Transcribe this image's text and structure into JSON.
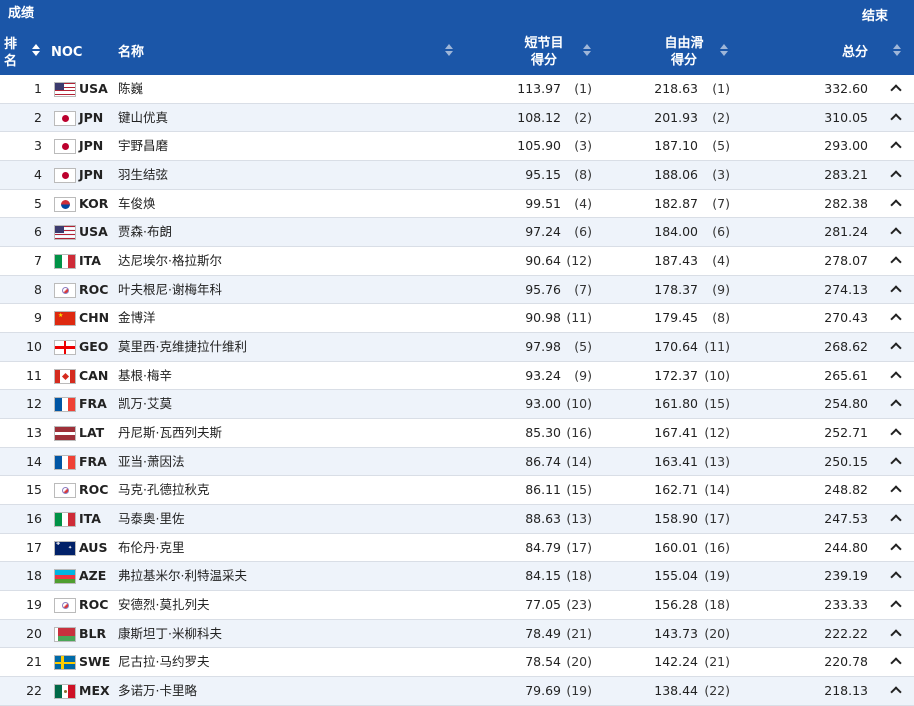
{
  "header": {
    "title": "成绩",
    "status": "结束",
    "columns": {
      "rank_line1": "排",
      "rank_line2": "名",
      "noc": "NOC",
      "name": "名称",
      "sp_line1": "短节目",
      "sp_line2": "得分",
      "fs_line1": "自由滑",
      "fs_line2": "得分",
      "total": "总分"
    }
  },
  "icons": {
    "sort": "sort-arrows-icon",
    "expand": "chevron-up-icon"
  },
  "colors": {
    "header_bg": "#1b56a8",
    "row_alt_bg": "#eef3fa"
  },
  "rows": [
    {
      "rank": "1",
      "noc": "USA",
      "name": "陈巍",
      "sp": "113.97",
      "sp_rank": "(1)",
      "fs": "218.63",
      "fs_rank": "(1)",
      "total": "332.60"
    },
    {
      "rank": "2",
      "noc": "JPN",
      "name": "键山优真",
      "sp": "108.12",
      "sp_rank": "(2)",
      "fs": "201.93",
      "fs_rank": "(2)",
      "total": "310.05"
    },
    {
      "rank": "3",
      "noc": "JPN",
      "name": "宇野昌磨",
      "sp": "105.90",
      "sp_rank": "(3)",
      "fs": "187.10",
      "fs_rank": "(5)",
      "total": "293.00"
    },
    {
      "rank": "4",
      "noc": "JPN",
      "name": "羽生结弦",
      "sp": "95.15",
      "sp_rank": "(8)",
      "fs": "188.06",
      "fs_rank": "(3)",
      "total": "283.21"
    },
    {
      "rank": "5",
      "noc": "KOR",
      "name": "车俊焕",
      "sp": "99.51",
      "sp_rank": "(4)",
      "fs": "182.87",
      "fs_rank": "(7)",
      "total": "282.38"
    },
    {
      "rank": "6",
      "noc": "USA",
      "name": "贾森·布朗",
      "sp": "97.24",
      "sp_rank": "(6)",
      "fs": "184.00",
      "fs_rank": "(6)",
      "total": "281.24"
    },
    {
      "rank": "7",
      "noc": "ITA",
      "name": "达尼埃尔·格拉斯尔",
      "sp": "90.64",
      "sp_rank": "(12)",
      "fs": "187.43",
      "fs_rank": "(4)",
      "total": "278.07"
    },
    {
      "rank": "8",
      "noc": "ROC",
      "name": "叶夫根尼·谢梅年科",
      "sp": "95.76",
      "sp_rank": "(7)",
      "fs": "178.37",
      "fs_rank": "(9)",
      "total": "274.13"
    },
    {
      "rank": "9",
      "noc": "CHN",
      "name": "金博洋",
      "sp": "90.98",
      "sp_rank": "(11)",
      "fs": "179.45",
      "fs_rank": "(8)",
      "total": "270.43"
    },
    {
      "rank": "10",
      "noc": "GEO",
      "name": "莫里西·克维捷拉什维利",
      "sp": "97.98",
      "sp_rank": "(5)",
      "fs": "170.64",
      "fs_rank": "(11)",
      "total": "268.62"
    },
    {
      "rank": "11",
      "noc": "CAN",
      "name": "基根·梅辛",
      "sp": "93.24",
      "sp_rank": "(9)",
      "fs": "172.37",
      "fs_rank": "(10)",
      "total": "265.61"
    },
    {
      "rank": "12",
      "noc": "FRA",
      "name": "凯万·艾莫",
      "sp": "93.00",
      "sp_rank": "(10)",
      "fs": "161.80",
      "fs_rank": "(15)",
      "total": "254.80"
    },
    {
      "rank": "13",
      "noc": "LAT",
      "name": "丹尼斯·瓦西列夫斯",
      "sp": "85.30",
      "sp_rank": "(16)",
      "fs": "167.41",
      "fs_rank": "(12)",
      "total": "252.71"
    },
    {
      "rank": "14",
      "noc": "FRA",
      "name": "亚当·萧因法",
      "sp": "86.74",
      "sp_rank": "(14)",
      "fs": "163.41",
      "fs_rank": "(13)",
      "total": "250.15"
    },
    {
      "rank": "15",
      "noc": "ROC",
      "name": "马克·孔德拉秋克",
      "sp": "86.11",
      "sp_rank": "(15)",
      "fs": "162.71",
      "fs_rank": "(14)",
      "total": "248.82"
    },
    {
      "rank": "16",
      "noc": "ITA",
      "name": "马泰奥·里佐",
      "sp": "88.63",
      "sp_rank": "(13)",
      "fs": "158.90",
      "fs_rank": "(17)",
      "total": "247.53"
    },
    {
      "rank": "17",
      "noc": "AUS",
      "name": "布伦丹·克里",
      "sp": "84.79",
      "sp_rank": "(17)",
      "fs": "160.01",
      "fs_rank": "(16)",
      "total": "244.80"
    },
    {
      "rank": "18",
      "noc": "AZE",
      "name": "弗拉基米尔·利特温采夫",
      "sp": "84.15",
      "sp_rank": "(18)",
      "fs": "155.04",
      "fs_rank": "(19)",
      "total": "239.19"
    },
    {
      "rank": "19",
      "noc": "ROC",
      "name": "安德烈·莫扎列夫",
      "sp": "77.05",
      "sp_rank": "(23)",
      "fs": "156.28",
      "fs_rank": "(18)",
      "total": "233.33"
    },
    {
      "rank": "20",
      "noc": "BLR",
      "name": "康斯坦丁·米柳科夫",
      "sp": "78.49",
      "sp_rank": "(21)",
      "fs": "143.73",
      "fs_rank": "(20)",
      "total": "222.22"
    },
    {
      "rank": "21",
      "noc": "SWE",
      "name": "尼古拉·马约罗夫",
      "sp": "78.54",
      "sp_rank": "(20)",
      "fs": "142.24",
      "fs_rank": "(21)",
      "total": "220.78"
    },
    {
      "rank": "22",
      "noc": "MEX",
      "name": "多诺万·卡里略",
      "sp": "79.69",
      "sp_rank": "(19)",
      "fs": "138.44",
      "fs_rank": "(22)",
      "total": "218.13"
    }
  ]
}
